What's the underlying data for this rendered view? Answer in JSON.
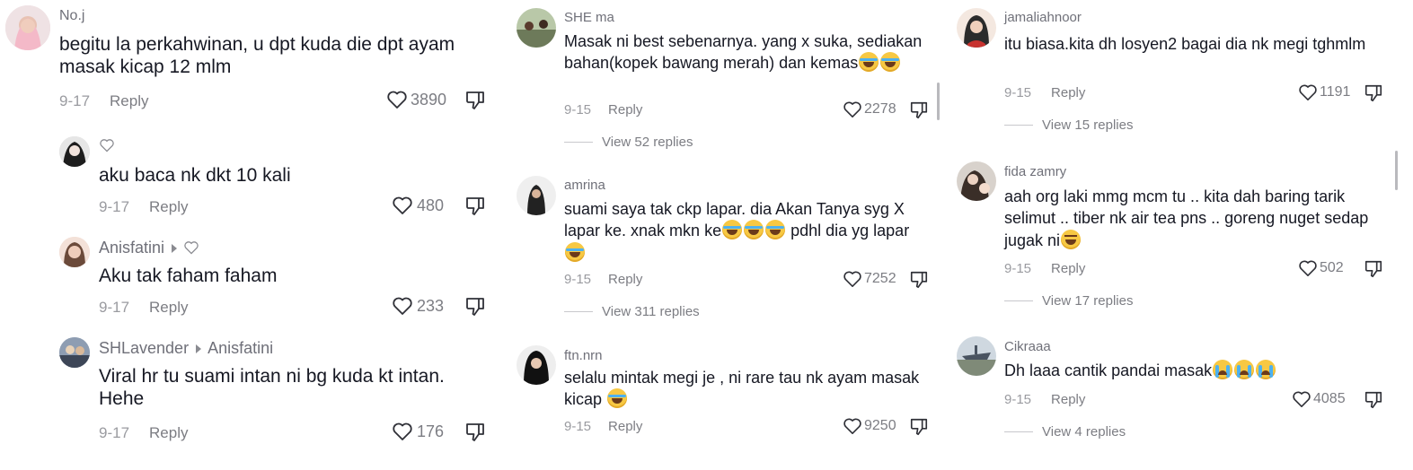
{
  "reply_label": "Reply",
  "colors": {
    "text": "#161823",
    "username": "#6f7079",
    "meta": "#9a9ba0",
    "icon": "#2f3037"
  },
  "col1": [
    {
      "user": "No.j",
      "text": "begitu la perkahwinan, u dpt kuda die dpt ayam masak kicap 12 mlm",
      "date": "9-17",
      "likes": "3890"
    },
    {
      "user": "",
      "user_icon": "heart-outline-icon",
      "text": "aku baca nk dkt 10 kali",
      "date": "9-17",
      "likes": "480"
    },
    {
      "user": "Anisfatini",
      "user_icon": "heart-outline-icon",
      "text": "Aku tak faham faham",
      "date": "9-17",
      "likes": "233"
    },
    {
      "user": "SHLavender",
      "reply_to": "Anisfatini",
      "text": "Viral hr tu suami intan ni bg kuda kt intan. Hehe",
      "date": "9-17",
      "likes": "176"
    }
  ],
  "col2": [
    {
      "user": "SHE ma",
      "text": "Masak ni best sebenarnya. yang x suka, sediakan bahan(kopek bawang merah) dan kemas",
      "emojis": [
        "laugh-cry-emoji",
        "laugh-cry-emoji"
      ],
      "date": "9-15",
      "likes": "2278",
      "view_replies": "View 52 replies"
    },
    {
      "user": "amrina",
      "text": "suami saya tak ckp lapar. dia Akan Tanya syg X lapar ke. xnak mkn ke",
      "text_after": "pdhl dia yg lapar",
      "emojis": [
        "laugh-cry-emoji",
        "laugh-cry-emoji",
        "laugh-cry-emoji",
        "laugh-cry-emoji"
      ],
      "date": "9-15",
      "likes": "7252",
      "view_replies": "View 311 replies"
    },
    {
      "user": "ftn.nrn",
      "text": "selalu mintak megi je , ni rare tau nk ayam masak kicap",
      "emojis": [
        "laugh-cry-emoji"
      ],
      "date": "9-15",
      "likes": "9250"
    }
  ],
  "col3": [
    {
      "user": "jamaliahnoor",
      "text": "itu biasa.kita dh losyen2 bagai dia nk megi tghmlm",
      "date": "9-15",
      "likes": "1191",
      "view_replies": "View 15 replies"
    },
    {
      "user": "fida zamry",
      "text": "aah org laki mmg mcm tu .. kita dah baring tarik selimut .. tiber nk air tea pns .. goreng nuget sedap jugak ni",
      "emojis": [
        "grinning-squint-emoji"
      ],
      "date": "9-15",
      "likes": "502",
      "view_replies": "View 17 replies"
    },
    {
      "user": "Cikraaa",
      "text": "Dh laaa cantik pandai masak",
      "emojis": [
        "crying-emoji",
        "crying-emoji",
        "crying-emoji"
      ],
      "date": "9-15",
      "likes": "4085",
      "view_replies": "View 4 replies"
    }
  ]
}
